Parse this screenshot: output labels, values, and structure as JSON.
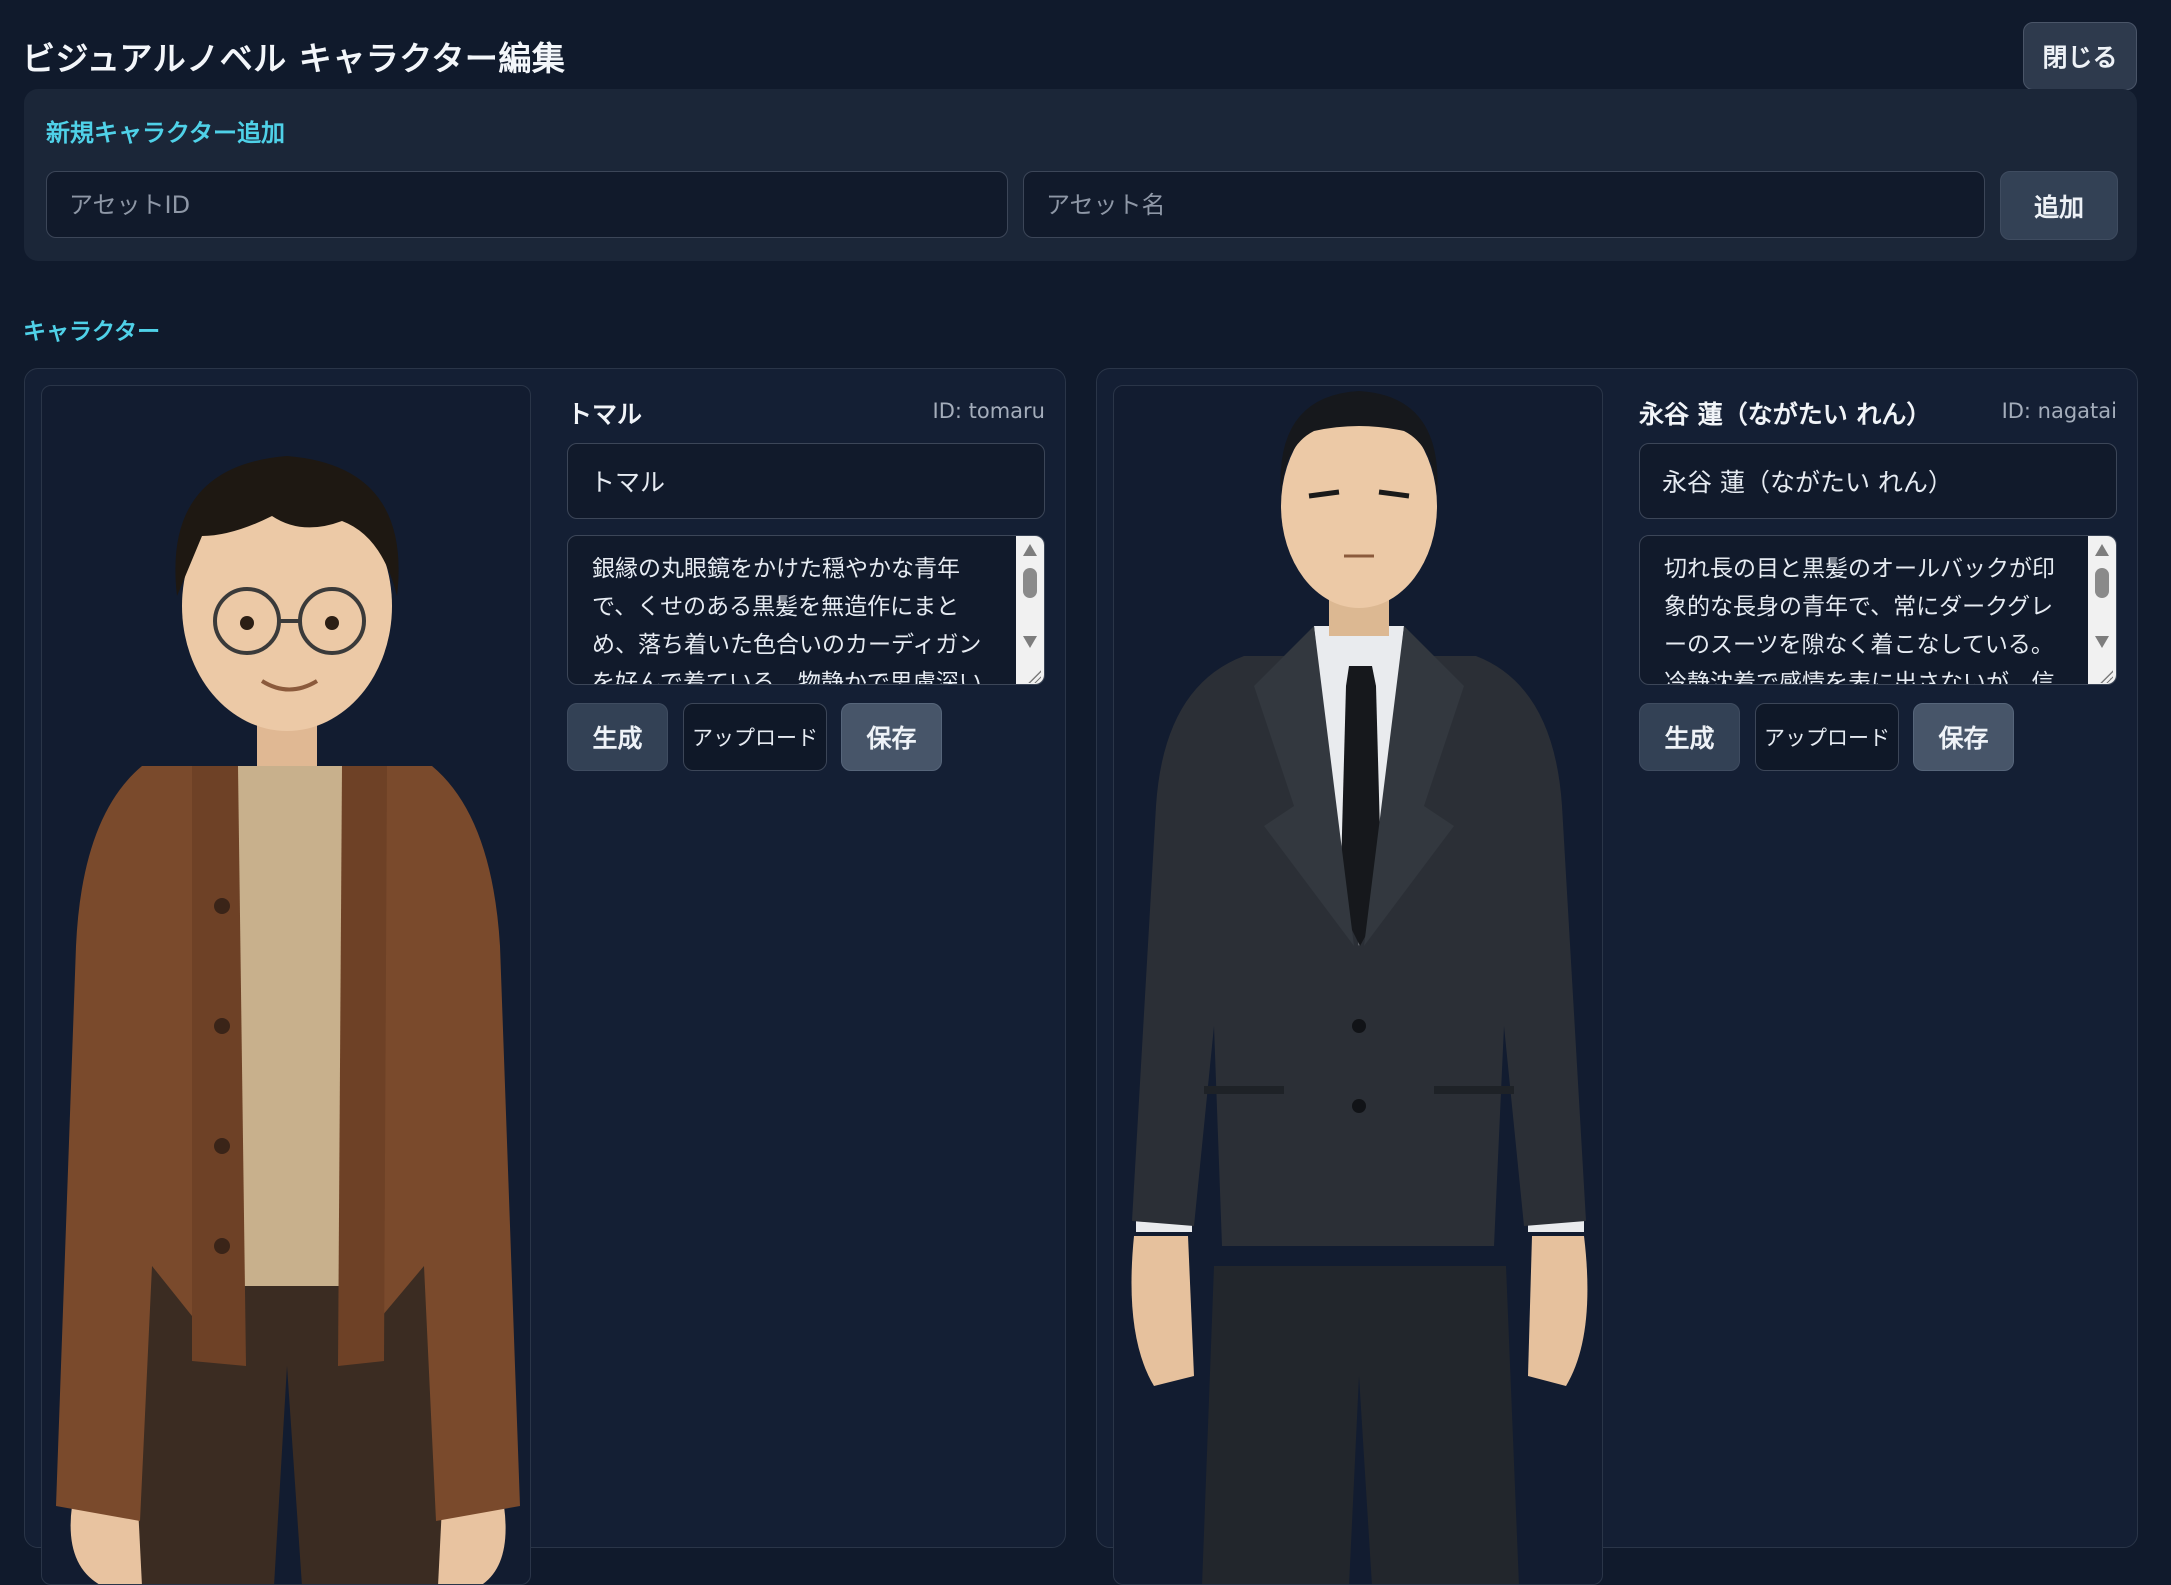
{
  "header": {
    "title": "ビジュアルノベル キャラクター編集",
    "close_label": "閉じる"
  },
  "add_panel": {
    "title": "新規キャラクター追加",
    "asset_id_placeholder": "アセットID",
    "asset_name_placeholder": "アセット名",
    "add_label": "追加"
  },
  "characters_section": {
    "title": "キャラクター"
  },
  "characters": [
    {
      "name": "トマル",
      "id_text": "ID: tomaru",
      "name_value": "トマル",
      "description": "銀縁の丸眼鏡をかけた穏やかな青年で、くせのある黒髪を無造作にまとめ、落ち着いた色合いのカーディガンを好んで着ている。物静かで思慮深い性格だ",
      "buttons": {
        "generate": "生成",
        "upload": "アップロード",
        "save": "保存"
      }
    },
    {
      "name": "永谷 蓮（ながたい れん）",
      "id_text": "ID: nagatai",
      "name_value": "永谷 蓮（ながたい れん）",
      "description": "切れ長の目と黒髪のオールバックが印象的な長身の青年で、常にダークグレーのスーツを隙なく着こなしている。冷静沈着で感情を表に出さないが、信頼し",
      "buttons": {
        "generate": "生成",
        "upload": "アップロード",
        "save": "保存"
      }
    }
  ],
  "colors": {
    "accent": "#4fd1e8",
    "background": "#101a2c",
    "panel": "#1b2638",
    "button": "#334155"
  }
}
